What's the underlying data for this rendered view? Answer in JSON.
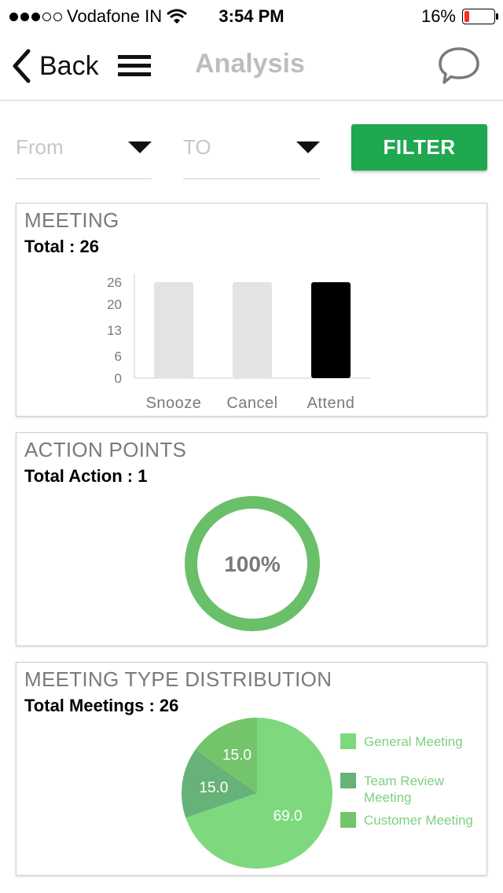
{
  "status_bar": {
    "carrier": "Vodafone IN",
    "time": "3:54 PM",
    "battery_percent": "16%",
    "battery_level": 0.16,
    "signal_bars_filled": 3,
    "signal_bars_total": 5,
    "icons": [
      "wifi-icon",
      "battery-icon"
    ]
  },
  "navbar": {
    "back_label": "Back",
    "title": "Analysis",
    "icons": [
      "chevron-left-icon",
      "menu-icon",
      "chat-icon"
    ]
  },
  "filters": {
    "from_placeholder": "From",
    "to_placeholder": "TO",
    "filter_label": "FILTER",
    "filter_color": "#1fa84f"
  },
  "meeting_card": {
    "title": "MEETING",
    "total": "Total : 26"
  },
  "action_card": {
    "title": "ACTION POINTS",
    "total": "Total Action : 1"
  },
  "distribution_card": {
    "title": "MEETING TYPE DISTRIBUTION",
    "total": "Total Meetings : 26"
  },
  "chart_data": [
    {
      "type": "bar",
      "categories": [
        "Snooze",
        "Cancel",
        "Attend"
      ],
      "values": [
        26,
        26,
        26
      ],
      "bar_colors": [
        "#e3e3e3",
        "#e3e3e3",
        "#000000"
      ],
      "yticks": [
        "0",
        "6",
        "13",
        "20",
        "26"
      ],
      "ylim": [
        0,
        26
      ]
    },
    {
      "type": "pie",
      "style": "donut",
      "values": [
        100
      ],
      "center_label": "100%",
      "color": "#6abf69"
    },
    {
      "type": "pie",
      "categories": [
        "General Meeting",
        "Team Review Meeting",
        "Customer Meeting"
      ],
      "values": [
        69.0,
        15.0,
        15.0
      ],
      "value_labels": [
        "69.0",
        "15.0",
        "15.0"
      ],
      "colors": [
        "#7ed97e",
        "#67b278",
        "#73c46b"
      ],
      "legend_placement": "right"
    }
  ]
}
